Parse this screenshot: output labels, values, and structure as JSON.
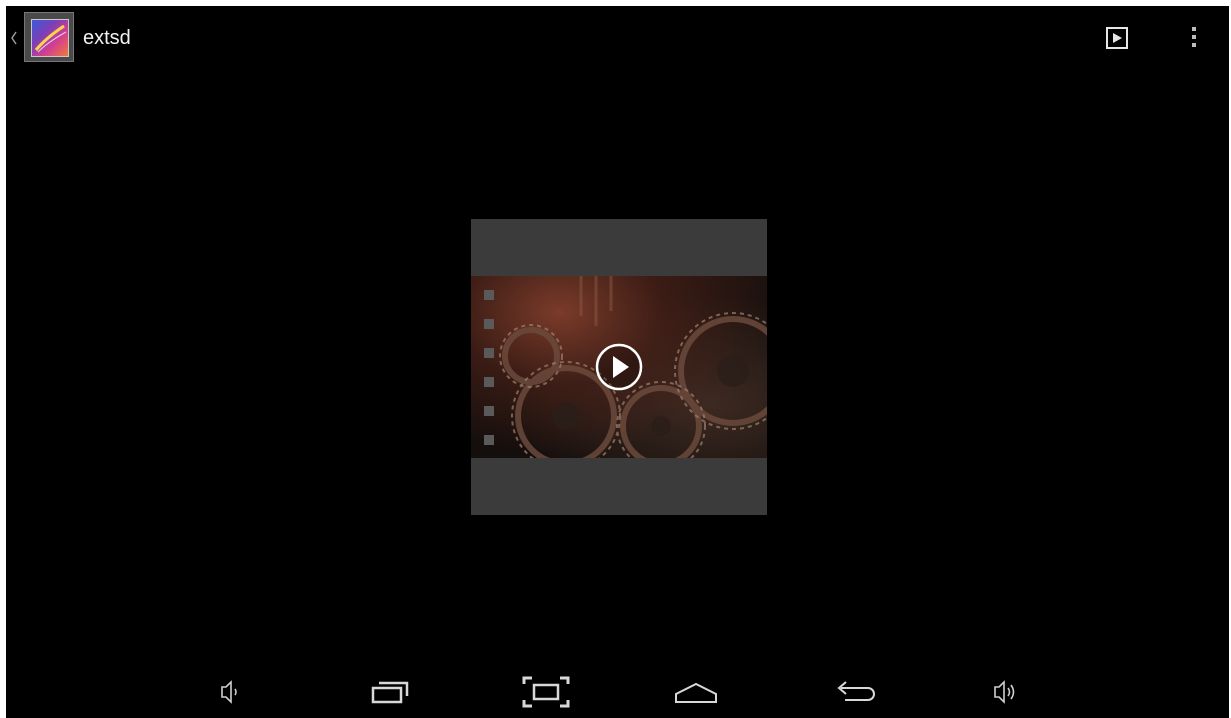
{
  "action_bar": {
    "title": "extsd",
    "icons": [
      "up-caret-icon",
      "gallery-app-icon",
      "slideshow-icon",
      "overflow-menu-icon"
    ]
  },
  "content": {
    "item_type": "video",
    "overlay_icon": "play-icon"
  },
  "navigation_bar": {
    "buttons": [
      "volume-down-icon",
      "recent-apps-icon",
      "screenshot-icon",
      "home-icon",
      "back-icon",
      "volume-up-icon"
    ]
  },
  "colors": {
    "background": "#000000",
    "thumbnail_bg": "#3b3b3b",
    "icon_color": "#d8d8d8"
  }
}
